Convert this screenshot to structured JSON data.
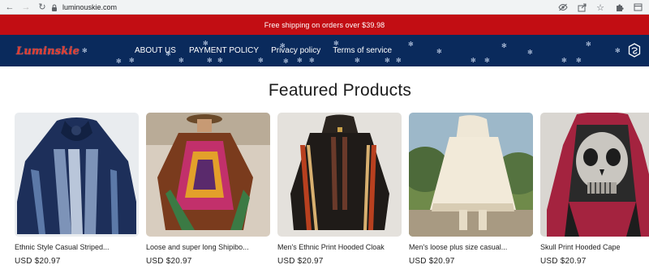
{
  "browser": {
    "url": "luminouskie.com",
    "icons": [
      "back-icon",
      "forward-icon",
      "reload-icon",
      "lock-icon",
      "eye-off-icon",
      "share-icon",
      "star-icon",
      "extensions-icon",
      "tab-icon"
    ]
  },
  "announcement": {
    "text": "Free shipping on orders over $39.98"
  },
  "header": {
    "logo": "Luminskie",
    "nav": [
      {
        "label": "ABOUT US"
      },
      {
        "label": "PAYMENT POLICY"
      },
      {
        "label": "Privacy policy"
      },
      {
        "label": "Terms of service"
      }
    ]
  },
  "section": {
    "title": "Featured Products"
  },
  "products": [
    {
      "name": "Ethnic Style Casual Striped...",
      "price": "USD $20.97"
    },
    {
      "name": "Loose and super long Shipibo...",
      "price": "USD $20.97"
    },
    {
      "name": "Men's Ethnic Print Hooded Cloak",
      "price": "USD $20.97"
    },
    {
      "name": "Men's loose plus size casual...",
      "price": "USD $20.97"
    },
    {
      "name": "Skull Print Hooded Cape",
      "price": "USD $20.97"
    }
  ],
  "colors": {
    "announcement_bg": "#c20d13",
    "header_bg": "#0a2a5c",
    "logo": "#e03a2f"
  }
}
